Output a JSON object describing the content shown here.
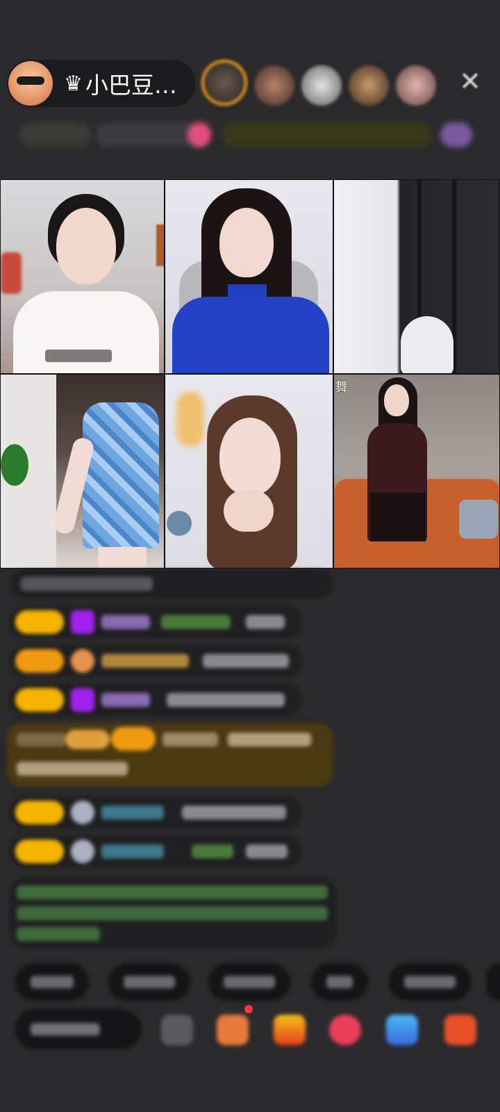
{
  "host": {
    "name": "小巴豆…",
    "crown_icon": "crown-icon"
  },
  "header": {
    "close_icon": "close-icon",
    "close_glyph": "✕"
  },
  "video_tiles": [
    {
      "label": ""
    },
    {
      "label": ""
    },
    {
      "label": ""
    },
    {
      "label": ""
    },
    {
      "label": ""
    },
    {
      "label": "舞"
    }
  ],
  "colors": {
    "background": "#2a2a2c",
    "badge": "#f4b400",
    "gem_purple": "#a020f0",
    "highlight_row": "#4a3a12"
  }
}
